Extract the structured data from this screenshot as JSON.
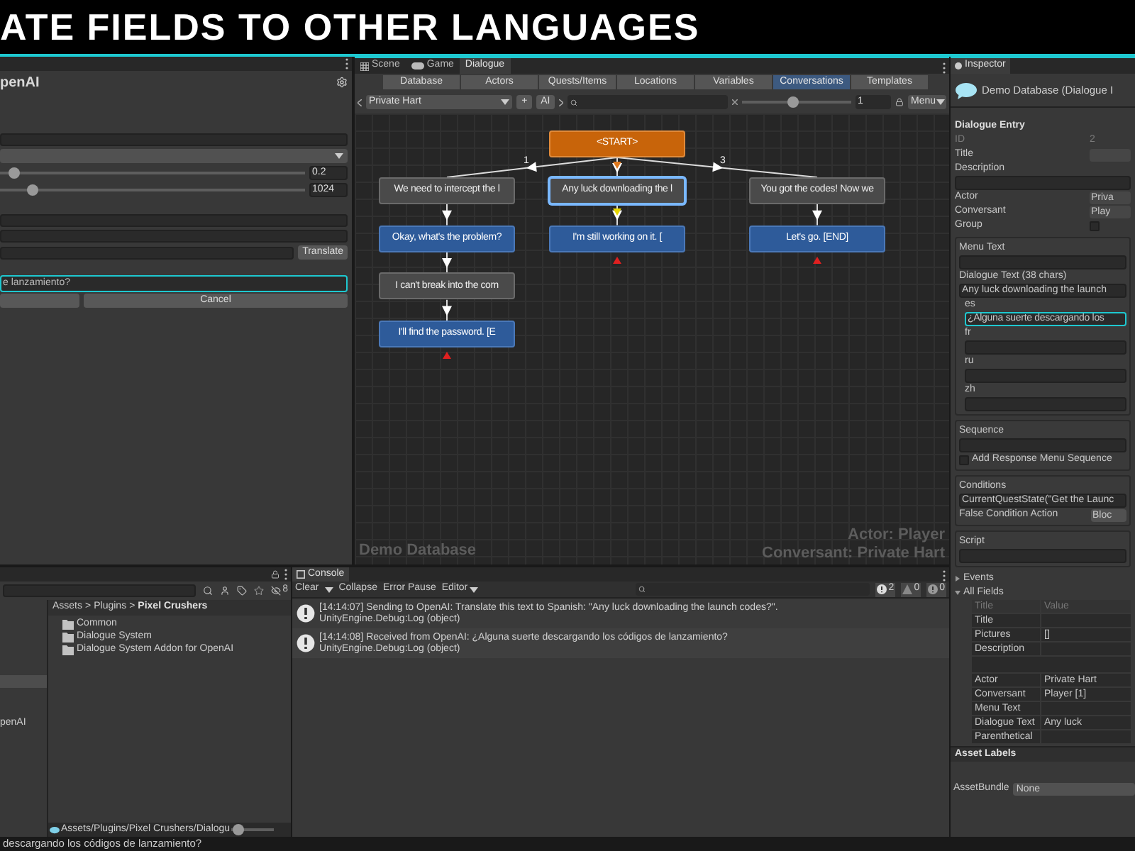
{
  "banner": {
    "title": "ATE FIELDS TO OTHER LANGUAGES"
  },
  "openai_panel": {
    "title": "penAI",
    "sliders": [
      {
        "level": 0.03,
        "value": "0.2"
      },
      {
        "level": 0.09,
        "value": "1024"
      }
    ],
    "translate_button": "Translate",
    "translation": "e lanzamiento?",
    "cancel_button": "Cancel"
  },
  "dialogue_editor": {
    "tabs": [
      {
        "label": "Scene",
        "kind": "scene",
        "selected": false
      },
      {
        "label": "Game",
        "kind": "game",
        "selected": false
      },
      {
        "label": "Dialogue",
        "kind": "plain",
        "selected": true
      }
    ],
    "sections": [
      {
        "label": "Database",
        "selected": false
      },
      {
        "label": "Actors",
        "selected": false
      },
      {
        "label": "Quests/Items",
        "selected": false
      },
      {
        "label": "Locations",
        "selected": false
      },
      {
        "label": "Variables",
        "selected": false
      },
      {
        "label": "Conversations",
        "selected": true
      },
      {
        "label": "Templates",
        "selected": false
      }
    ],
    "conversation": "Private Hart",
    "add_button": "+",
    "ai_button": "AI",
    "zoom": {
      "level": 0.47,
      "value": "1"
    },
    "menu": "Menu",
    "graph": {
      "root": {
        "text": "<START>",
        "kind": "start",
        "selected": false,
        "color": "#e07a1f",
        "children": [
          {
            "text": "We need to intercept the l",
            "kind": "npc",
            "selected": false,
            "link_label": "1",
            "children": [
              {
                "text": "Okay, what's the problem?",
                "kind": "player",
                "selected": false,
                "children": [
                  {
                    "text": "I can't break into the com",
                    "kind": "npc",
                    "selected": false,
                    "children": [
                      {
                        "text": "I'll find the password. [E",
                        "kind": "player",
                        "selected": false,
                        "color": "#e02020"
                      }
                    ]
                  }
                ]
              }
            ]
          },
          {
            "text": "Any luck downloading the l",
            "kind": "npc",
            "selected": true,
            "color": "#e8d800",
            "children": [
              {
                "text": "I'm still working on it. [",
                "kind": "player",
                "selected": false,
                "color": "#e02020"
              }
            ]
          },
          {
            "text": "You got the codes! Now we",
            "kind": "npc",
            "selected": false,
            "link_label": "3",
            "children": [
              {
                "text": "Let's go. [END]",
                "kind": "player",
                "selected": false,
                "color": "#e02020"
              }
            ]
          }
        ]
      }
    },
    "database_name": "Demo Database",
    "actor": "Actor: Player",
    "conversant": "Conversant: Private Hart"
  },
  "project": {
    "hidden_count": "8",
    "tree": [
      {
        "label": "penAI"
      }
    ],
    "breadcrumb": [
      "Assets",
      "Plugins",
      "Pixel Crushers"
    ],
    "breadcrumb_separator": ">",
    "folders": [
      "Common",
      "Dialogue System",
      "Dialogue System Addon for OpenAI"
    ],
    "footer_path": "Assets/Plugins/Pixel Crushers/Dialogu",
    "icon_size": {
      "level": 0.05
    }
  },
  "console": {
    "title": "Console",
    "toolbar": [
      {
        "kind": "button",
        "label": "Clear"
      },
      {
        "kind": "caret"
      },
      {
        "kind": "button",
        "label": "Collapse"
      },
      {
        "kind": "button",
        "label": "Error Pause"
      },
      {
        "kind": "menu",
        "label": "Editor"
      }
    ],
    "counts": [
      {
        "kind": "info",
        "value": "2"
      },
      {
        "kind": "warning",
        "value": "0"
      },
      {
        "kind": "error",
        "value": "0"
      }
    ],
    "entries": [
      {
        "message": "[14:14:07] Sending to OpenAI: Translate this text to Spanish: \"Any luck downloading the launch codes?\".",
        "source": "UnityEngine.Debug:Log (object)"
      },
      {
        "message": "[14:14:08] Received from OpenAI: ¿Alguna suerte descargando los códigos de lanzamiento?",
        "source": "UnityEngine.Debug:Log (object)"
      }
    ]
  },
  "inspector": {
    "title": "Inspector",
    "header": "Demo Database (Dialogue I",
    "section": "Dialogue Entry",
    "fields": [
      {
        "kind": "value",
        "label": "ID",
        "value": "2",
        "disabled": true
      },
      {
        "kind": "value",
        "label": "Title",
        "disabled": false
      },
      {
        "kind": "textarea",
        "label": "Description",
        "disabled": false
      },
      {
        "kind": "value",
        "label": "Actor",
        "value": "Priva",
        "disabled": false
      },
      {
        "kind": "value",
        "label": "Conversant",
        "value": "Play",
        "disabled": false
      },
      {
        "kind": "checkbox",
        "label": "Group",
        "checked": false,
        "disabled": false
      }
    ],
    "text_box": {
      "menu_text_label": "Menu Text",
      "dialogue_text_label": "Dialogue Text (38 chars)",
      "dialogue_text": "Any luck downloading the launch",
      "translations": [
        {
          "language": "es",
          "value": "¿Alguna suerte descargando los",
          "focused": true
        },
        {
          "language": "fr",
          "focused": false
        },
        {
          "language": "ru",
          "focused": false
        },
        {
          "language": "zh",
          "focused": false
        }
      ]
    },
    "sequence_box": {
      "label": "Sequence",
      "checkbox": {
        "label": "Add Response Menu Sequence",
        "checked": false
      }
    },
    "conditions_box": {
      "label": "Conditions",
      "value": "CurrentQuestState(\"Get the Launc",
      "false_action_label": "False Condition Action",
      "false_action": "Bloc"
    },
    "script_box": {
      "label": "Script"
    },
    "foldouts": [
      {
        "label": "Events",
        "expanded": false
      },
      {
        "label": "All Fields",
        "expanded": true
      }
    ],
    "all_fields": {
      "columns": [
        "Title",
        "Value"
      ],
      "rows": [
        {
          "kind": "field",
          "title": "Title"
        },
        {
          "kind": "field",
          "title": "Pictures",
          "value": "[]"
        },
        {
          "kind": "field",
          "title": "Description"
        },
        {
          "kind": "wide"
        },
        {
          "kind": "field",
          "title": "Actor",
          "value": "Private Hart"
        },
        {
          "kind": "field",
          "title": "Conversant",
          "value": "Player [1]"
        },
        {
          "kind": "field",
          "title": "Menu Text"
        },
        {
          "kind": "field",
          "title": "Dialogue Text",
          "value": "Any luck"
        },
        {
          "kind": "field",
          "title": "Parenthetical"
        }
      ]
    },
    "asset_labels": "Asset Labels",
    "asset_bundle": {
      "label": "AssetBundle",
      "value": "None"
    }
  },
  "status_bar": {
    "text": "descargando los códigos de lanzamiento?"
  }
}
